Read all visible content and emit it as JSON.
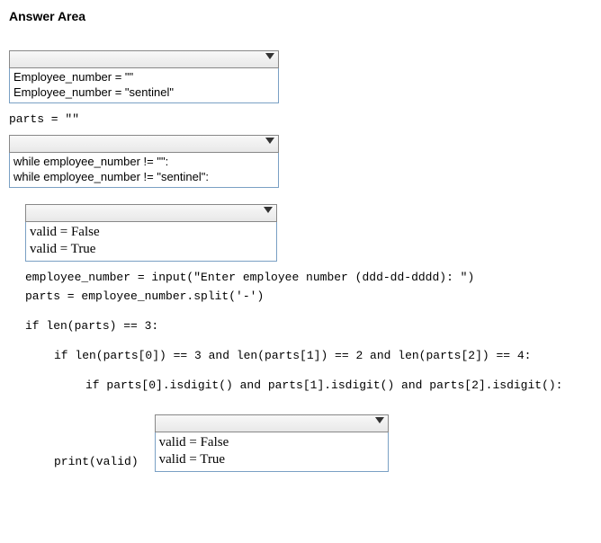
{
  "title": "Answer Area",
  "dropdown1": {
    "opt1": "Employee_number = \"\"",
    "opt2": "Employee_number = \"sentinel\""
  },
  "code1": "parts = \"\"",
  "dropdown2": {
    "opt1": "while employee_number != \"\":",
    "opt2": "while employee_number != \"sentinel\":"
  },
  "dropdown3": {
    "opt1": "valid = False",
    "opt2": "valid = True"
  },
  "code2": "employee_number = input(\"Enter employee number (ddd-dd-dddd): \")",
  "code3": "parts = employee_number.split('-')",
  "code4": "if len(parts) == 3:",
  "code5": "if len(parts[0]) == 3 and len(parts[1]) == 2 and len(parts[2]) == 4:",
  "code6": "if parts[0].isdigit() and parts[1].isdigit() and parts[2].isdigit():",
  "code7": "print(valid)",
  "dropdown4": {
    "opt1": "valid = False",
    "opt2": "valid = True"
  }
}
